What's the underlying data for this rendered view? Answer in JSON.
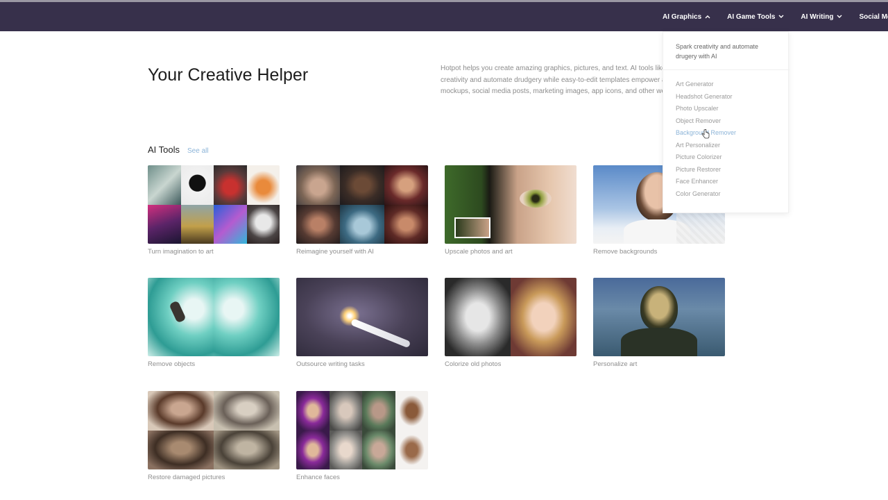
{
  "nav": {
    "items": [
      {
        "label": "AI Graphics",
        "expanded": true
      },
      {
        "label": "AI Game Tools",
        "expanded": false
      },
      {
        "label": "AI Writing",
        "expanded": false
      },
      {
        "label": "Social Media Gr",
        "expanded": false
      }
    ]
  },
  "hero": {
    "title": "Your Creative Helper",
    "description_lines": [
      "Hotpot helps you create amazing graphics, pictures, and text. AI tools like AI",
      "creativity and automate drudgery while easy-to-edit templates empower an",
      "mockups, social media posts, marketing images, app icons, and other work"
    ]
  },
  "section": {
    "title": "AI Tools",
    "see_all": "See all"
  },
  "cards": [
    {
      "label": "Turn imagination to art",
      "thumb": "art-collage"
    },
    {
      "label": "Reimagine yourself with AI",
      "thumb": "portrait-collage"
    },
    {
      "label": "Upscale photos and art",
      "thumb": "eye-closeup"
    },
    {
      "label": "Remove backgrounds",
      "thumb": "woman-portrait"
    },
    {
      "label": "Remove objects",
      "thumb": "surfer-wave"
    },
    {
      "label": "Outsource writing tasks",
      "thumb": "pen-sparks"
    },
    {
      "label": "Colorize old photos",
      "thumb": "bw-to-color"
    },
    {
      "label": "Personalize art",
      "thumb": "mona-lisa"
    },
    {
      "label": "Restore damaged pictures",
      "thumb": "old-photos"
    },
    {
      "label": "Enhance faces",
      "thumb": "faces-grid"
    }
  ],
  "dropdown": {
    "tagline": "Spark creativity and automate drugery with AI",
    "items": [
      "Art Generator",
      "Headshot Generator",
      "Photo Upscaler",
      "Object Remover",
      "Background Remover",
      "Art Personalizer",
      "Picture Colorizer",
      "Picture Restorer",
      "Face Enhancer",
      "Color Generator"
    ],
    "hovered_index": 4
  },
  "colors": {
    "topbar": "#37304b",
    "link": "#8cb4d8",
    "muted_text": "#8e8e8e"
  }
}
